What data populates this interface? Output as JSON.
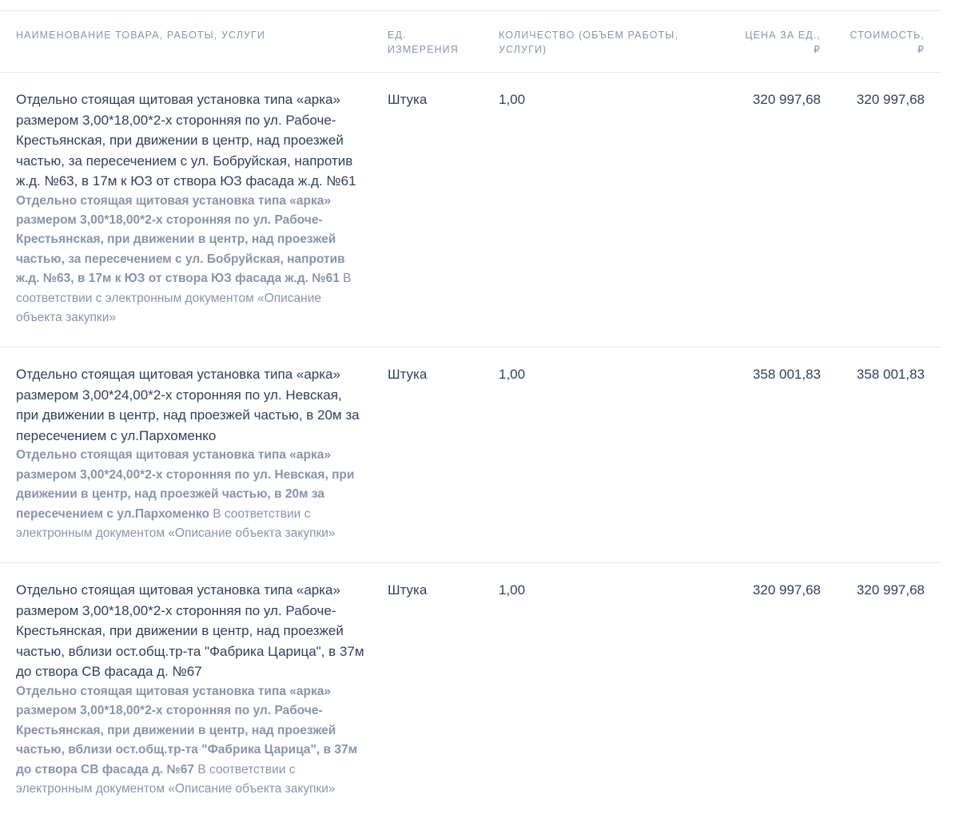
{
  "table": {
    "headers": {
      "name": "НАИМЕНОВАНИЕ ТОВАРА, РАБОТЫ, УСЛУГИ",
      "unit": "ЕД.\nИЗМЕРЕНИЯ",
      "qty": "КОЛИЧЕСТВО (ОБЪЕМ РАБОТЫ,\nУСЛУГИ)",
      "price": "ЦЕНА ЗА ЕД.,\n₽",
      "total": "СТОИМОСТЬ,\n₽"
    },
    "rows": [
      {
        "name": "Отдельно стоящая щитовая установка типа «арка» размером 3,00*18,00*2-х сторонняя по ул. Рабоче-Крестьянская, при движении в центр, над проезжей частью, за пересечением с ул. Бобруйская, напротив ж.д. №63, в 17м к ЮЗ от створа ЮЗ фасада ж.д. №61",
        "sub_bold": "Отдельно стоящая щитовая установка типа «арка» размером 3,00*18,00*2-х сторонняя по ул. Рабоче-Крестьянская, при движении в центр, над проезжей частью, за пересечением с ул. Бобруйская, напротив ж.д. №63, в 17м к ЮЗ от створа ЮЗ фасада ж.д. №61",
        "sub_note": " В соответствии с электронным документом «Описание объекта закупки»",
        "unit": "Штука",
        "qty": "1,00",
        "price": "320 997,68",
        "total": "320 997,68"
      },
      {
        "name": "Отдельно стоящая щитовая установка типа «арка» размером 3,00*24,00*2-х сторонняя по ул. Невская, при движении в центр, над проезжей частью, в 20м за пересечением с ул.Пархоменко",
        "sub_bold": "Отдельно стоящая щитовая установка типа «арка» размером 3,00*24,00*2-х сторонняя по ул. Невская, при движении в центр, над проезжей частью, в 20м за пересечением с ул.Пархоменко",
        "sub_note": " В соответствии с электронным документом «Описание объекта закупки»",
        "unit": "Штука",
        "qty": "1,00",
        "price": "358 001,83",
        "total": "358 001,83"
      },
      {
        "name": "Отдельно стоящая щитовая установка типа «арка» размером 3,00*18,00*2-х сторонняя по ул. Рабоче-Крестьянская, при движении в центр, над проезжей частью, вблизи ост.общ.тр-та \"Фабрика Царица\", в 37м до створа СВ фасада д. №67",
        "sub_bold": "Отдельно стоящая щитовая установка типа «арка» размером 3,00*18,00*2-х сторонняя по ул. Рабоче-Крестьянская, при движении в центр, над проезжей частью, вблизи ост.общ.тр-та \"Фабрика Царица\", в 37м до створа СВ фасада д. №67",
        "sub_note": " В соответствии с электронным документом «Описание объекта закупки»",
        "unit": "Штука",
        "qty": "1,00",
        "price": "320 997,68",
        "total": "320 997,68"
      }
    ]
  }
}
